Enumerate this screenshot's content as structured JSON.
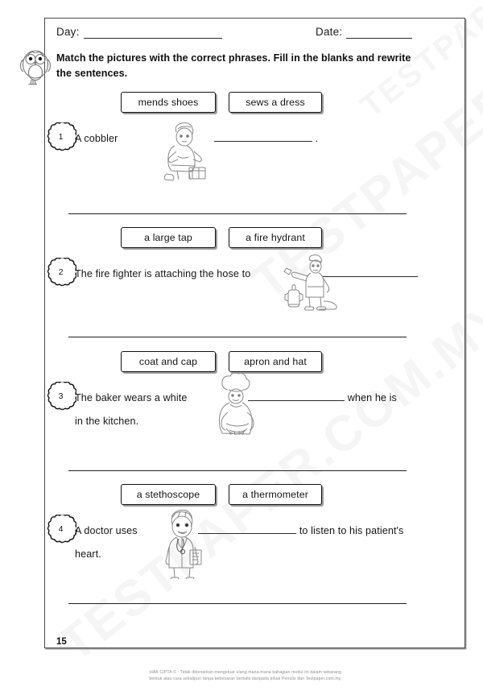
{
  "header": {
    "day_label": "Day:",
    "date_label": "Date:"
  },
  "instruction": {
    "icon": "owl-icon",
    "text": "Match the pictures with the correct phrases. Fill in the blanks and rewrite the sentences."
  },
  "questions": [
    {
      "number": "1",
      "choices": [
        "mends shoes",
        "sews a dress"
      ],
      "clipart": "cobbler-mending-shoes-image",
      "sentence_before": "A cobbler",
      "sentence_after": ".",
      "blank_width": 122,
      "second_line": ""
    },
    {
      "number": "2",
      "choices": [
        "a large tap",
        "a fire hydrant"
      ],
      "clipart": "fire-fighter-with-hydrant-image",
      "sentence_before": "The fire fighter is attaching the hose to",
      "sentence_after": "",
      "blank_width": 118,
      "second_line": ""
    },
    {
      "number": "3",
      "choices": [
        "coat and cap",
        "apron and hat"
      ],
      "clipart": "baker-with-bread-image",
      "sentence_before": "The baker wears a white",
      "sentence_after": "when he is",
      "blank_width": 120,
      "second_line": "in the kitchen."
    },
    {
      "number": "4",
      "choices": [
        "a stethoscope",
        "a thermometer"
      ],
      "clipart": "doctor-with-clipboard-image",
      "sentence_before": "A doctor uses",
      "sentence_after": "to listen to his patient's",
      "blank_width": 122,
      "second_line": "heart."
    }
  ],
  "page_number": "15",
  "footer": {
    "line1": "HAK CIPTA © : Tidak dibenarkan mengeluar ulang mana-mana bahagian modul ini dalam sebarang",
    "line2": "bentuk atau cara sekalipun tanpa kebenaran bertulis daripada pihak Penulis dan Testpaper.com.my."
  },
  "watermark": {
    "text": "TESTPAPER.COM.MY"
  },
  "colors": {
    "ink": "#141414",
    "rule": "#2b2b2b",
    "frame": "#4a4a4a",
    "footer_text": "#8d8d8d"
  }
}
